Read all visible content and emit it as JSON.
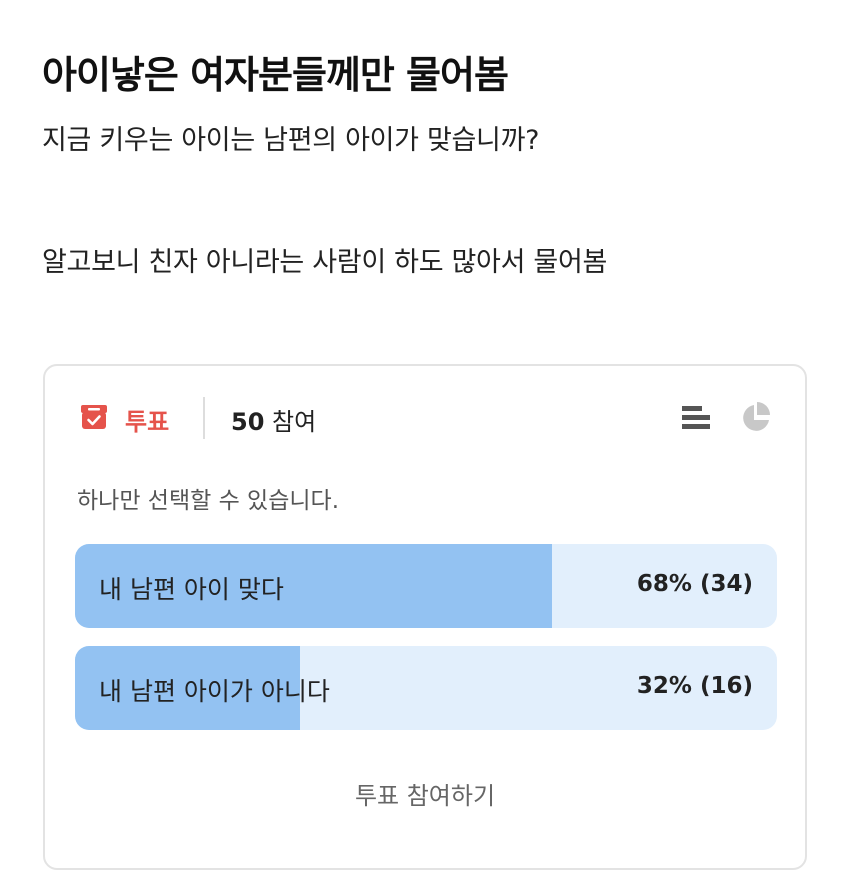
{
  "post": {
    "title": "아이낳은 여자분들께만 물어봄",
    "body_lines": [
      "지금 키우는 아이는 남편의 아이가 맞습니까?",
      "알고보니 친자 아니라는 사람이 하도 많아서 물어봄"
    ]
  },
  "poll": {
    "label": "투표",
    "participant_count": "50",
    "participant_suffix": "참여",
    "instruction": "하나만 선택할 수 있습니다.",
    "options": [
      {
        "label": "내 남편 아이 맞다",
        "percent": 68,
        "result_text": "68% (34)"
      },
      {
        "label": "내 남편 아이가 아니다",
        "percent": 32,
        "result_text": "32% (16)"
      }
    ],
    "vote_button_label": "투표 참여하기",
    "icons": {
      "poll": "ballot-box-icon",
      "list_view": "bar-list-icon",
      "pie_view": "pie-chart-icon"
    },
    "colors": {
      "accent_red": "#e5534b",
      "bar_fill": "#93c2f2",
      "bar_track": "#e2effc",
      "icon_gray": "#555555",
      "icon_light_gray": "#c8c8c8"
    }
  }
}
